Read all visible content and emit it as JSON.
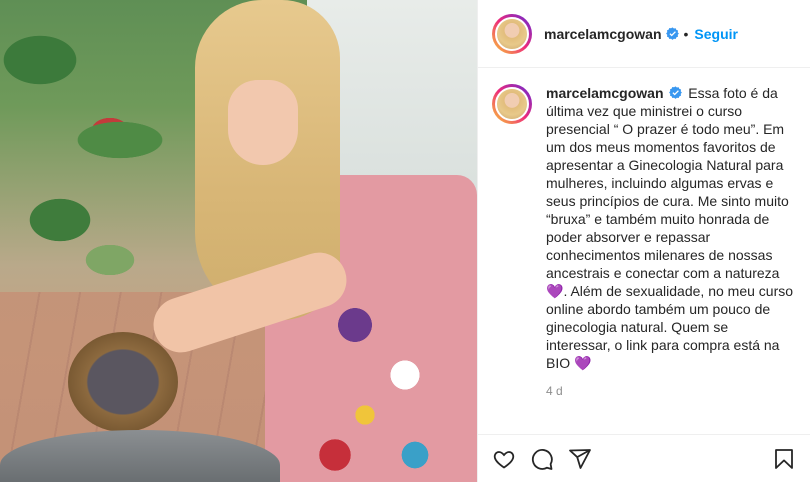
{
  "post": {
    "header": {
      "username": "marcelamcgowan",
      "separator": "•",
      "follow_label": "Seguir"
    },
    "caption": {
      "username": "marcelamcgowan",
      "text_part1": "Essa foto é da última vez que ministrei o curso presencial “ O prazer é todo meu”. Em um dos meus momentos favoritos de apresentar a Ginecologia Natural para mulheres, incluindo algumas ervas e seus princípios de cura. Me sinto muito “bruxa” e também muito honrada de poder absorver e repassar conhecimentos milenares de nossas ancestrais e conectar com a natureza",
      "heart_1": "💜",
      "text_part2": ". Além de sexualidade, no meu curso online abordo também um pouco de ginecologia natural. Quem se interessar, o link para compra está na BIO",
      "heart_2": "💜"
    },
    "timestamp": "4 d",
    "icons": [
      "verified-badge",
      "heart-icon",
      "comment-icon",
      "share-icon",
      "bookmark-icon"
    ],
    "colors": {
      "accent": "#0095f6",
      "verified": "#3897f0",
      "muted": "#8e8e8e",
      "text": "#262626"
    }
  }
}
